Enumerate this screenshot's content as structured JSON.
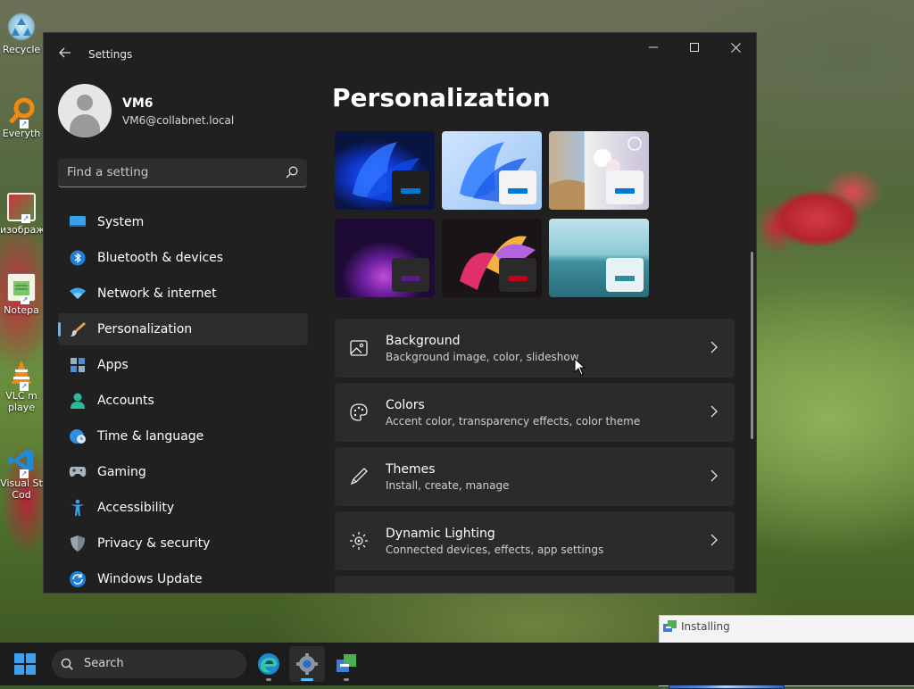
{
  "desktop": {
    "icons": [
      {
        "icon": "recycle-bin-icon",
        "label": "Recycle"
      },
      {
        "icon": "everything-app-icon",
        "label": "Everyth"
      },
      {
        "icon": "image-file-icon",
        "label": "изображ"
      },
      {
        "icon": "notepad-icon",
        "label": "Notepa"
      },
      {
        "icon": "vlc-icon",
        "label": "VLC m"
      },
      {
        "icon": "vlc-icon",
        "label": "playe"
      },
      {
        "icon": "vscode-icon",
        "label": "Visual St"
      },
      {
        "icon": "vscode-icon",
        "label": "Cod"
      }
    ]
  },
  "window": {
    "title": "Settings",
    "controls": {
      "minimize": "minimize-icon",
      "maximize": "maximize-icon",
      "close": "close-icon"
    }
  },
  "profile": {
    "name": "VM6",
    "email": "VM6@collabnet.local"
  },
  "search": {
    "placeholder": "Find a setting",
    "value": ""
  },
  "nav": {
    "items": [
      {
        "label": "System",
        "icon": "system-icon",
        "active": false
      },
      {
        "label": "Bluetooth & devices",
        "icon": "bluetooth-icon",
        "active": false
      },
      {
        "label": "Network & internet",
        "icon": "wifi-icon",
        "active": false
      },
      {
        "label": "Personalization",
        "icon": "brush-icon",
        "active": true
      },
      {
        "label": "Apps",
        "icon": "apps-icon",
        "active": false
      },
      {
        "label": "Accounts",
        "icon": "accounts-icon",
        "active": false
      },
      {
        "label": "Time & language",
        "icon": "globe-clock-icon",
        "active": false
      },
      {
        "label": "Gaming",
        "icon": "gamepad-icon",
        "active": false
      },
      {
        "label": "Accessibility",
        "icon": "accessibility-icon",
        "active": false
      },
      {
        "label": "Privacy & security",
        "icon": "shield-icon",
        "active": false
      },
      {
        "label": "Windows Update",
        "icon": "update-icon",
        "active": false
      }
    ]
  },
  "content": {
    "title": "Personalization",
    "themes": [
      {
        "name": "windows-dark",
        "accent": "#0078d4"
      },
      {
        "name": "windows-light",
        "accent": "#0078d4"
      },
      {
        "name": "windows-spotlight",
        "accent": "#0078d4"
      },
      {
        "name": "glow",
        "accent": "#5b1a8c"
      },
      {
        "name": "captured-motion",
        "accent": "#c40014"
      },
      {
        "name": "flow",
        "accent": "#2a8ea0"
      }
    ],
    "settings": [
      {
        "title": "Background",
        "subtitle": "Background image, color, slideshow",
        "icon": "image-icon"
      },
      {
        "title": "Colors",
        "subtitle": "Accent color, transparency effects, color theme",
        "icon": "palette-icon"
      },
      {
        "title": "Themes",
        "subtitle": "Install, create, manage",
        "icon": "pen-icon"
      },
      {
        "title": "Dynamic Lighting",
        "subtitle": "Connected devices, effects, app settings",
        "icon": "lighting-icon"
      }
    ]
  },
  "installer": {
    "title": "Installing"
  },
  "taskbar": {
    "search_label": "Search",
    "apps": [
      {
        "name": "edge",
        "icon": "edge-icon",
        "active": false
      },
      {
        "name": "settings",
        "icon": "settings-gear-icon",
        "active": true
      },
      {
        "name": "installer",
        "icon": "installer-icon",
        "active": false
      }
    ]
  },
  "colors": {
    "accent": "#4cc2ff",
    "window_bg": "#202020",
    "card_bg": "#2b2b2b"
  }
}
